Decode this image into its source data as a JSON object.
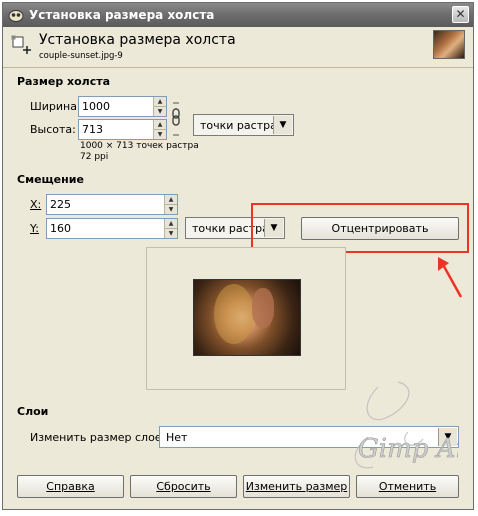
{
  "window": {
    "title": "Установка размера холста",
    "close_glyph": "✕"
  },
  "header": {
    "title": "Установка размера холста",
    "subtitle": "couple-sunset.jpg-9"
  },
  "canvas_size": {
    "section_title": "Размер холста",
    "width_label": "Ширина:",
    "width_value": "1000",
    "height_label": "Высота:",
    "height_value": "713",
    "unit": "точки растра",
    "info_line1": "1000 × 713 точек растра",
    "info_line2": "72 ppi"
  },
  "offset": {
    "section_title": "Смещение",
    "x_label": "X:",
    "x_value": "225",
    "y_label": "Y:",
    "y_value": "160",
    "unit": "точки растра",
    "center_button": "Отцентрировать"
  },
  "layers": {
    "section_title": "Слои",
    "resize_label": "Изменить размер слоев:",
    "resize_value": "Нет"
  },
  "buttons": {
    "help": "Справка",
    "reset": "Сбросить",
    "resize": "Изменить размер",
    "cancel": "Отменить"
  },
  "colors": {
    "highlight": "#ee3325",
    "titlebar": "#6f6f6f",
    "dialog_bg": "#ece9d8"
  },
  "icons": [
    "gimp-app-icon",
    "close-icon",
    "canvas-size-icon",
    "chain-link-icon",
    "chevron-down-icon",
    "spin-up-icon",
    "spin-down-icon",
    "red-arrow-annotation",
    "gimp-watermark"
  ],
  "watermark": {
    "text": "Gimp Artery"
  }
}
